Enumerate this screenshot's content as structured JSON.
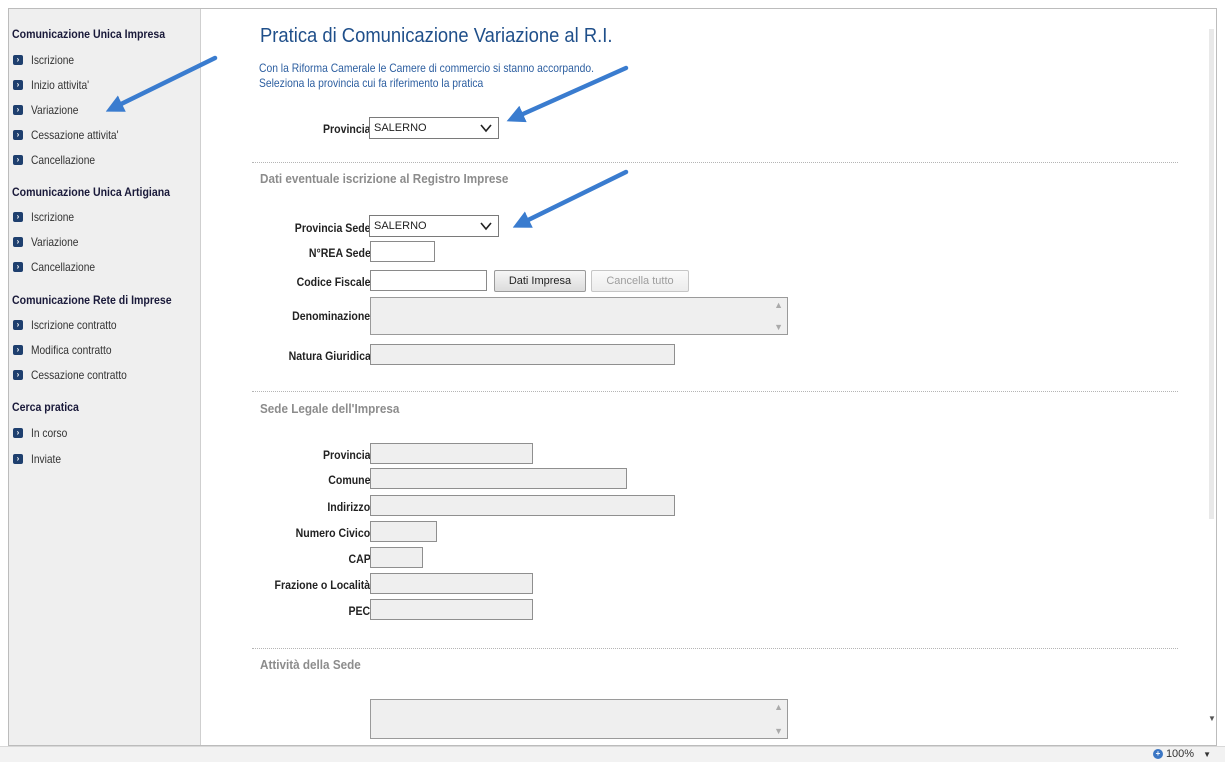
{
  "sidebar": {
    "sections": [
      {
        "title": "Comunicazione Unica Impresa",
        "items": [
          {
            "label": "Iscrizione"
          },
          {
            "label": "Inizio attivita'"
          },
          {
            "label": "Variazione"
          },
          {
            "label": "Cessazione attivita'"
          },
          {
            "label": "Cancellazione"
          }
        ]
      },
      {
        "title": "Comunicazione Unica Artigiana",
        "items": [
          {
            "label": "Iscrizione"
          },
          {
            "label": "Variazione"
          },
          {
            "label": "Cancellazione"
          }
        ]
      },
      {
        "title": "Comunicazione Rete di Imprese",
        "items": [
          {
            "label": "Iscrizione contratto"
          },
          {
            "label": "Modifica contratto"
          },
          {
            "label": "Cessazione contratto"
          }
        ]
      },
      {
        "title": "Cerca pratica",
        "items": [
          {
            "label": "In corso"
          },
          {
            "label": "Inviate"
          }
        ]
      }
    ]
  },
  "main": {
    "title": "Pratica di Comunicazione Variazione al R.I.",
    "intro_line1": "Con la Riforma Camerale le Camere di commercio si stanno accorpando.",
    "intro_line2": "Seleziona la provincia cui fa riferimento la pratica",
    "provincia_label": "Provincia:",
    "provincia_value": "SALERNO"
  },
  "registro": {
    "title": "Dati eventuale iscrizione al Registro Imprese",
    "provincia_sede_label": "Provincia Sede:",
    "provincia_sede_value": "SALERNO",
    "nrea_label": "N°REA Sede:",
    "nrea_value": "",
    "codice_fiscale_label": "Codice Fiscale:",
    "codice_fiscale_value": "",
    "dati_impresa_button": "Dati Impresa",
    "cancella_tutto_button": "Cancella tutto",
    "denominazione_label": "Denominazione:",
    "natura_giuridica_label": "Natura Giuridica:"
  },
  "sede_legale": {
    "title": "Sede Legale dell'Impresa",
    "provincia_label": "Provincia:",
    "comune_label": "Comune:",
    "indirizzo_label": "Indirizzo:",
    "numero_civico_label": "Numero Civico:",
    "cap_label": "CAP:",
    "frazione_label": "Frazione o Località:",
    "pec_label": "PEC:"
  },
  "attivita": {
    "title": "Attività della Sede"
  },
  "statusbar": {
    "zoom": "100%"
  },
  "colors": {
    "arrow": "#3a7ccf",
    "title": "#1f4f8a",
    "sidebar_bullet": "#1e3f6e"
  }
}
